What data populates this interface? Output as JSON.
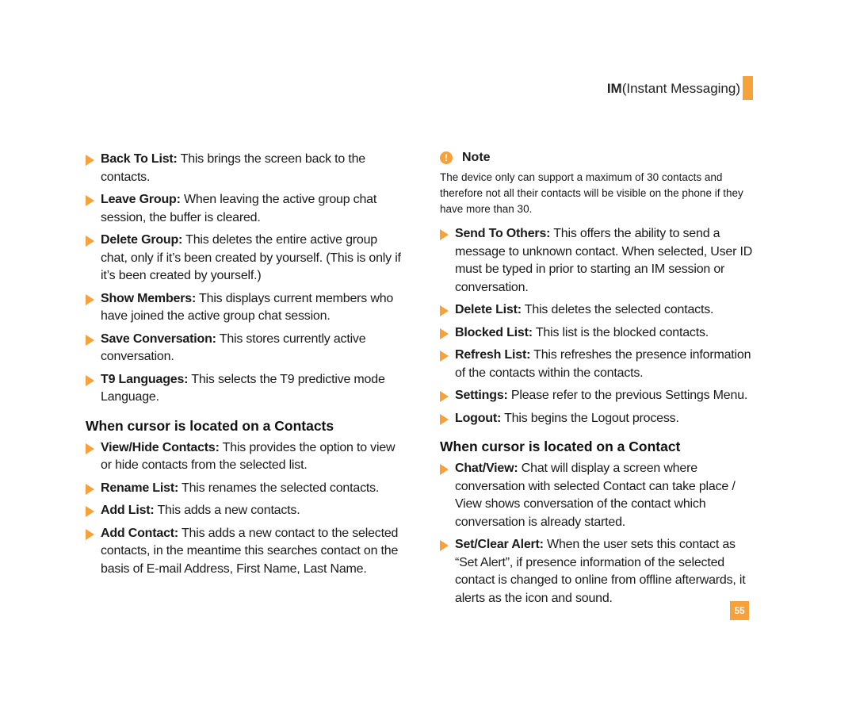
{
  "header": {
    "bold": "IM",
    "rest": "(Instant Messaging)",
    "accent_color": "#f7a13a"
  },
  "left_column": {
    "items": [
      {
        "term": "Back To List:",
        "desc": " This brings the screen back to the contacts."
      },
      {
        "term": "Leave Group:",
        "desc": " When leaving the active group chat session, the buffer is cleared."
      },
      {
        "term": "Delete Group:",
        "desc": " This deletes the entire active group chat, only if it’s been created by yourself. (This is only if it’s been created by yourself.)"
      },
      {
        "term": "Show Members:",
        "desc": " This displays current members who have joined the active group chat session."
      },
      {
        "term": "Save Conversation:",
        "desc": " This stores currently active conversation."
      },
      {
        "term": "T9 Languages:",
        "desc": " This selects the T9 predictive mode Language."
      }
    ],
    "section_title": "When cursor is located on a Contacts",
    "section_items": [
      {
        "term": "View/Hide Contacts:",
        "desc": " This provides the option to view or hide contacts from the selected list."
      },
      {
        "term": "Rename List:",
        "desc": " This renames the selected contacts."
      },
      {
        "term": "Add List:",
        "desc": " This adds a new contacts."
      },
      {
        "term": "Add Contact:",
        "desc": " This adds a new contact to the selected contacts, in the meantime this searches contact on the basis of E-mail Address, First Name, Last Name."
      }
    ]
  },
  "right_column": {
    "note": {
      "icon_glyph": "!",
      "title": "Note",
      "text": "The device only can support a maximum of 30 contacts and therefore not all their contacts will be visible on the phone if they have more than 30."
    },
    "items": [
      {
        "term": "Send To Others:",
        "desc": " This offers the ability to send a message to unknown contact. When selected, User ID must be typed in prior to starting an IM session or conversation."
      },
      {
        "term": "Delete List:",
        "desc": " This deletes the selected contacts."
      },
      {
        "term": "Blocked List:",
        "desc": " This list is the blocked contacts."
      },
      {
        "term": "Refresh List:",
        "desc": " This refreshes the presence information of the contacts within the contacts."
      },
      {
        "term": "Settings:",
        "desc": " Please refer to the previous Settings Menu."
      },
      {
        "term": "Logout:",
        "desc": " This begins the Logout process."
      }
    ],
    "section_title": "When cursor is located on a Contact",
    "section_items": [
      {
        "term": "Chat/View:",
        "desc": " Chat will display a screen where conversation with selected Contact can take place / View shows conversation of the contact which conversation is already started."
      },
      {
        "term": "Set/Clear Alert:",
        "desc": " When the user sets this contact as “Set Alert”, if presence information of the selected contact is changed to online from offline afterwards, it alerts as the icon and sound."
      }
    ]
  },
  "page_number": "55"
}
